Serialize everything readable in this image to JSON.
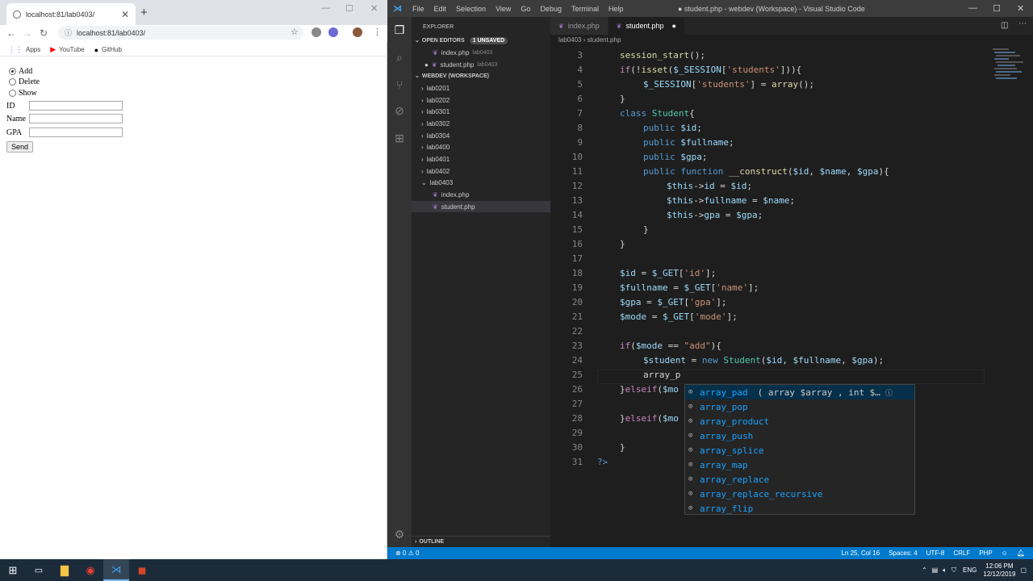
{
  "browser": {
    "tab_title": "localhost:81/lab0403/",
    "url": "localhost:81/lab0403/",
    "bookmarks": [
      {
        "label": "Apps",
        "icon": "apps-grid-icon"
      },
      {
        "label": "YouTube",
        "icon": "youtube-icon"
      },
      {
        "label": "GitHub",
        "icon": "github-icon"
      }
    ],
    "form": {
      "modes": [
        "Add",
        "Delete",
        "Show"
      ],
      "selected_mode": "Add",
      "fields": [
        {
          "label": "ID",
          "value": ""
        },
        {
          "label": "Name",
          "value": ""
        },
        {
          "label": "GPA",
          "value": ""
        }
      ],
      "submit_label": "Send"
    }
  },
  "vscode": {
    "menu": [
      "File",
      "Edit",
      "Selection",
      "View",
      "Go",
      "Debug",
      "Terminal",
      "Help"
    ],
    "window_title": "● student.php - webdev (Workspace) - Visual Studio Code",
    "explorer_label": "EXPLORER",
    "open_editors_label": "OPEN EDITORS",
    "unsaved_badge": "1 UNSAVED",
    "open_editors": [
      {
        "name": "index.php",
        "path": "lab0403"
      },
      {
        "name": "student.php",
        "path": "lab0403"
      }
    ],
    "workspace_label": "WEBDEV (WORKSPACE)",
    "folders": [
      "lab0201",
      "lab0202",
      "lab0301",
      "lab0302",
      "lab0304",
      "lab0400",
      "lab0401",
      "lab0402",
      "lab0403"
    ],
    "lab0403_files": [
      "index.php",
      "student.php"
    ],
    "outline_label": "OUTLINE",
    "tabs": [
      {
        "name": "index.php"
      },
      {
        "name": "student.php"
      }
    ],
    "breadcrumb": "lab0403 ›  student.php",
    "line_numbers": [
      "3",
      "4",
      "5",
      "6",
      "7",
      "8",
      "9",
      "10",
      "11",
      "12",
      "13",
      "14",
      "15",
      "16",
      "17",
      "18",
      "19",
      "20",
      "21",
      "22",
      "23",
      "24",
      "25",
      "26",
      "27",
      "28",
      "29",
      "30",
      "31"
    ],
    "suggestions": [
      {
        "label": "array_pad",
        "detail": "( array $array , int $…"
      },
      {
        "label": "array_pop",
        "detail": ""
      },
      {
        "label": "array_product",
        "detail": ""
      },
      {
        "label": "array_push",
        "detail": ""
      },
      {
        "label": "array_splice",
        "detail": ""
      },
      {
        "label": "array_map",
        "detail": ""
      },
      {
        "label": "array_replace",
        "detail": ""
      },
      {
        "label": "array_replace_recursive",
        "detail": ""
      },
      {
        "label": "array_flip",
        "detail": ""
      }
    ],
    "status": {
      "problems": "⊗ 0 ⚠ 0",
      "cursor": "Ln 25, Col 16",
      "spaces": "Spaces: 4",
      "encoding": "UTF-8",
      "eol": "CRLF",
      "language": "PHP"
    }
  },
  "taskbar": {
    "language": "ENG",
    "time": "12:06 PM",
    "date": "12/12/2019"
  }
}
